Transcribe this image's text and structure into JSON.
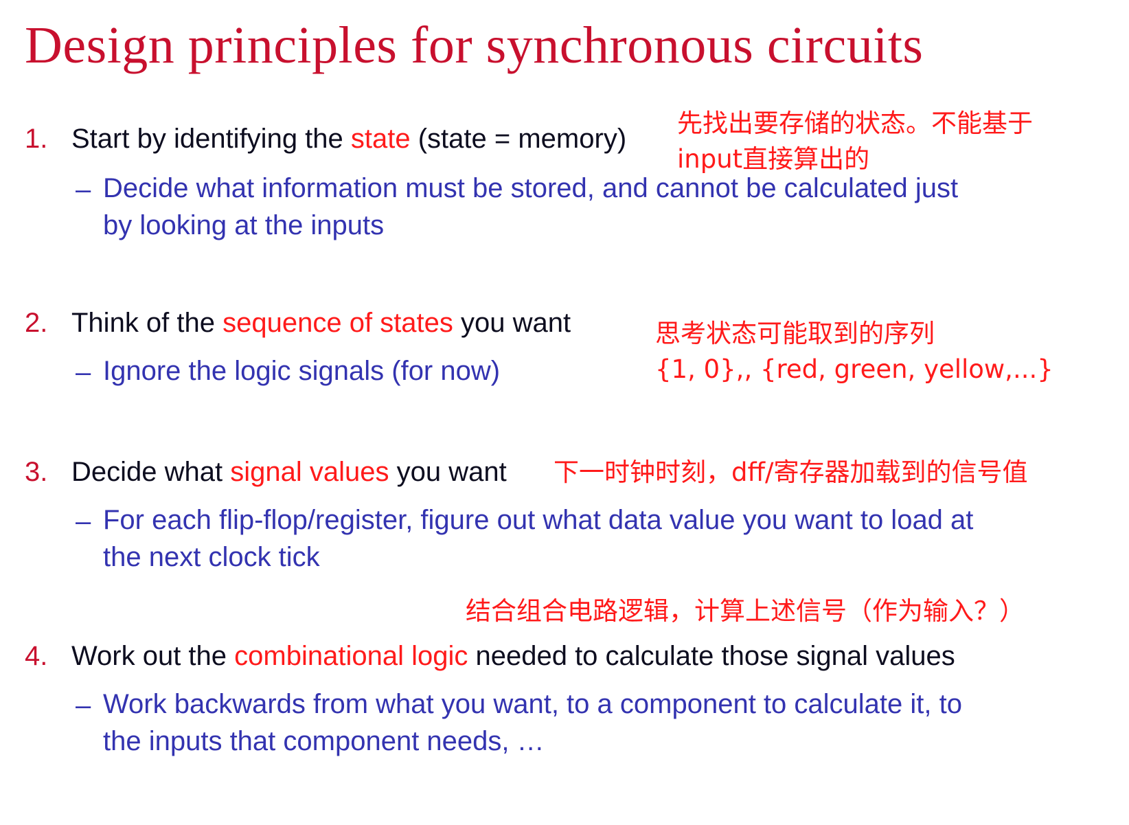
{
  "title": "Design principles for synchronous circuits",
  "items": [
    {
      "number": "1.",
      "parts": [
        "Start by identifying the ",
        "state",
        " (state = memory)"
      ],
      "sub_lines": [
        "Decide what information must be stored, and cannot be calculated just",
        "by looking at the inputs"
      ],
      "annotation": [
        "先找出要存储的状态。不能基于",
        "input直接算出的"
      ]
    },
    {
      "number": "2.",
      "parts": [
        "Think of the ",
        "sequence of states",
        " you want"
      ],
      "sub_lines": [
        "Ignore the logic signals (for now)"
      ],
      "annotation": [
        "思考状态可能取到的序列",
        "{1, 0},, {red, green, yellow,...}"
      ]
    },
    {
      "number": "3.",
      "parts": [
        "Decide what ",
        "signal values",
        " you want"
      ],
      "sub_lines": [
        "For each flip-flop/register, figure out what data value you want to load at",
        "the next clock tick"
      ],
      "annotation": [
        "下一时钟时刻，dff/寄存器加载到的信号值"
      ]
    },
    {
      "number": "4.",
      "parts": [
        "Work out the ",
        "combinational logic",
        " needed to calculate those signal values"
      ],
      "sub_lines": [
        "Work backwards from what you want, to a component to calculate it, to",
        "the inputs that component needs, …"
      ],
      "annotation": [
        "结合组合电路逻辑，计算上述信号（作为输入？）"
      ]
    }
  ],
  "colors": {
    "title": "#c8102e",
    "highlight": "#ff1a1a",
    "sub_text": "#3333b0",
    "body_text": "#0d0d1f",
    "annotation": "#ff1a1a"
  }
}
